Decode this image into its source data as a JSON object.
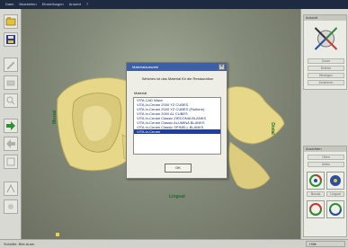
{
  "menu": [
    "Datei",
    "Bearbeiten",
    "Einstellungen",
    "Ansicht",
    "?"
  ],
  "viewport": {
    "label_left": "Mesial",
    "label_right": "Distal",
    "label_bottom": "Lingual"
  },
  "dialog": {
    "title": "Materialauswahl",
    "close": "×",
    "question": "Welches ist das Material für die Restauration",
    "list_label": "Material",
    "items": [
      "VITA CAD Waxx",
      "VITA In-Ceram 2000 YZ CUBES",
      "VITA In-Ceram 2000 YZ CUBES (Fluiform)",
      "VITA In-Ceram 2000 AL CUBES",
      "VITA In-Ceram Classic ZIRCONIA BLANKS",
      "VITA In-Ceram Classic ALUMINA BLANKS",
      "VITA In-Ceram Classic SPINELL BLANKS",
      "VITA In-Ceram"
    ],
    "selected_index": 7,
    "ok_label": "OK"
  },
  "right_panel": {
    "top_title": "Ansicht",
    "bottom_title": "Ansichten",
    "top_buttons": [
      "Zoom",
      "Drehen",
      "Bewegen",
      "Zentrieren"
    ],
    "bottom_buttons": [
      "Oben",
      "Unten"
    ],
    "view_labels": [
      "",
      "",
      "Buccal",
      "Lingual"
    ]
  },
  "status": {
    "left": "Schnitte: Bild-Ausb.",
    "right": "Hilfe"
  },
  "colors": {
    "selection": "#1f3f9a",
    "dialog_title": "#3c5fa5",
    "tooth": "#e7d889",
    "label": "#1e6b2a"
  }
}
